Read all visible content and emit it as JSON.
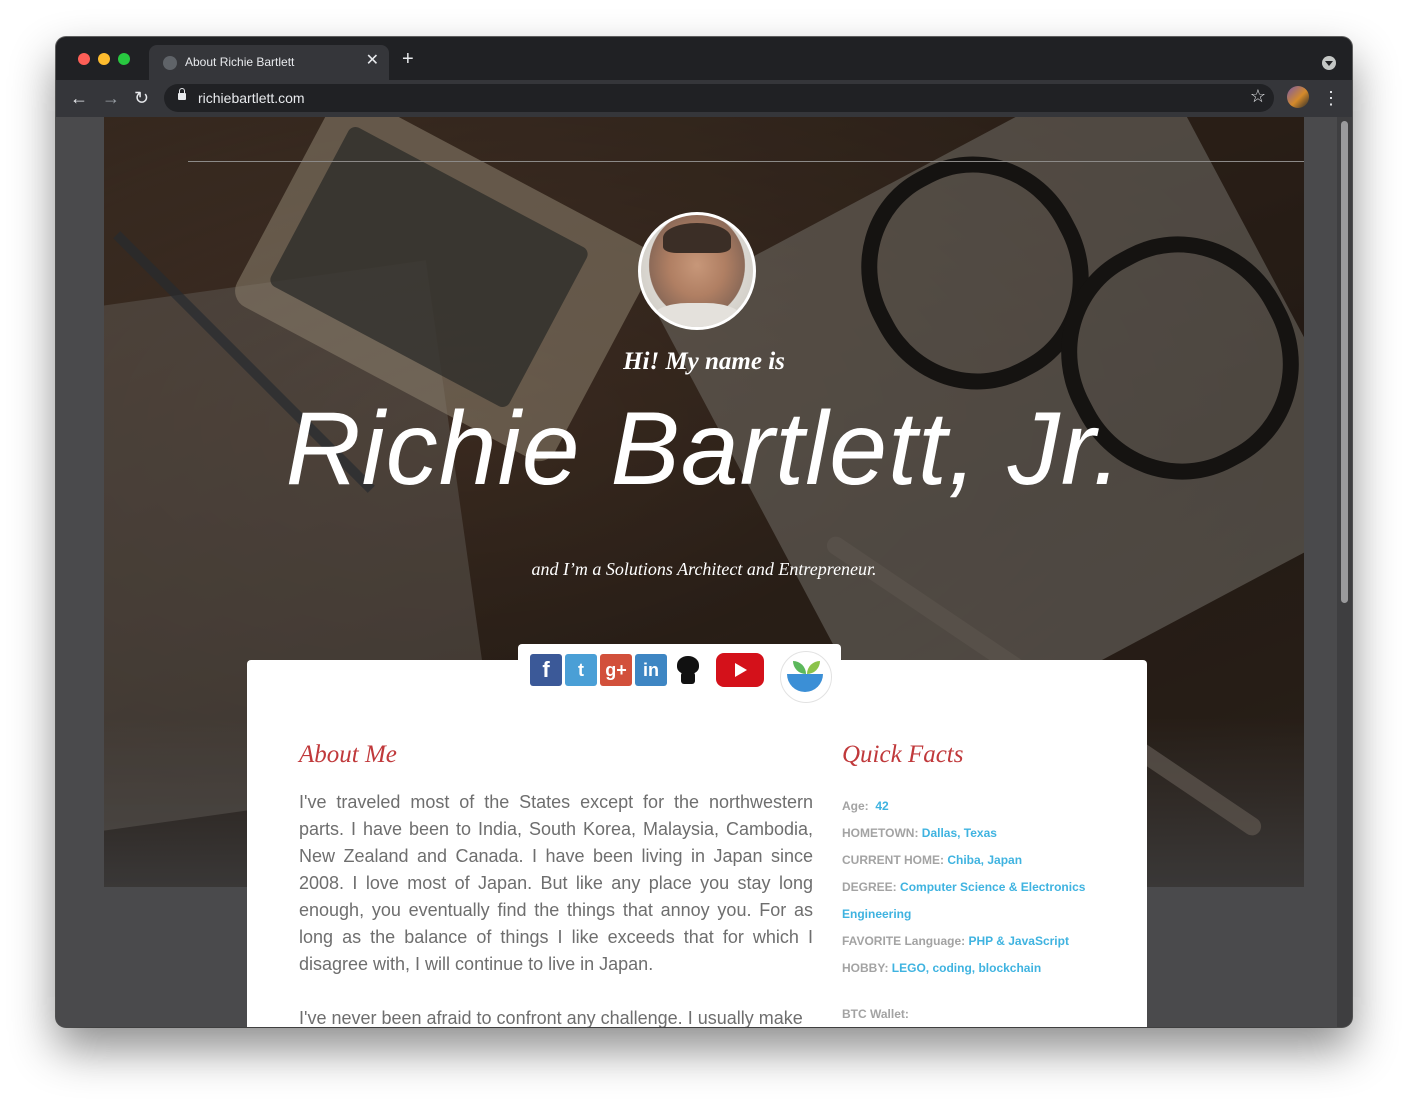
{
  "browser": {
    "tab_title": "About Richie Bartlett",
    "url": "richiebartlett.com",
    "close_glyph": "✕",
    "new_tab_glyph": "+",
    "back_glyph": "←",
    "forward_glyph": "→",
    "reload_glyph": "↻",
    "star_glyph": "☆",
    "menu_glyph": "⋮"
  },
  "hero": {
    "greeting": "Hi! My name is",
    "name": "Richie Bartlett, Jr.",
    "tagline": "and I’m a Solutions Architect and Entrepreneur."
  },
  "social": {
    "facebook_glyph": "f",
    "twitter_glyph": "t",
    "googleplus_glyph": "g+",
    "linkedin_glyph": "in"
  },
  "about": {
    "title": "About Me",
    "paragraph1": "I've traveled most of the States except for the northwestern parts. I have been to India, South Korea, Malaysia, Cambodia, New Zealand and Canada. I have been living in Japan since 2008. I love most of Japan. But like any place you stay long enough, you eventually find the things that annoy you. For as long as the balance of things I like exceeds that for which I disagree with, I will continue to live in Japan.",
    "paragraph2": "I've never been afraid to confront any challenge. I usually make"
  },
  "facts": {
    "title": "Quick Facts",
    "items": [
      {
        "label": "Age:",
        "value": "42"
      },
      {
        "label": "HOMETOWN:",
        "value": "Dallas, Texas"
      },
      {
        "label": "CURRENT HOME:",
        "value": "Chiba, Japan"
      },
      {
        "label": "DEGREE:",
        "value": "Computer Science & Electronics Engineering"
      },
      {
        "label": "FAVORITE Language:",
        "value": "PHP & JavaScript"
      },
      {
        "label": "HOBBY:",
        "value": "LEGO, coding, blockchain"
      }
    ],
    "btc_label": "BTC Wallet:"
  },
  "colors": {
    "accent_red": "#c0393b",
    "link_blue": "#3fb3e0"
  }
}
